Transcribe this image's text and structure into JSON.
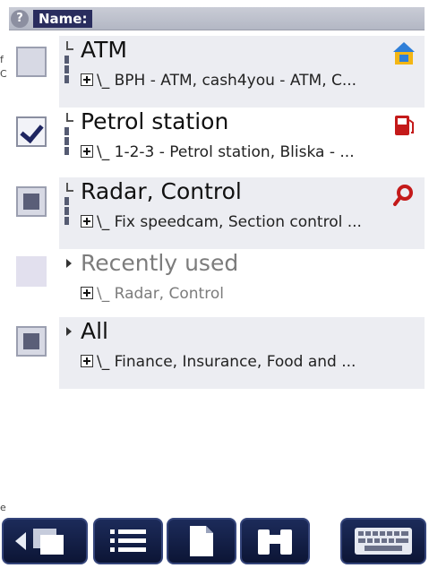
{
  "header": {
    "help_icon": "?",
    "title": "Name:"
  },
  "edge_fragments": [
    "f",
    "C",
    "e"
  ],
  "categories": [
    {
      "name": "ATM",
      "subtitle": "\\_ BPH - ATM, cash4you - ATM, C...",
      "checkbox": "empty",
      "icon": "atm-icon"
    },
    {
      "name": "Petrol station",
      "subtitle": "\\_ 1-2-3 - Petrol station, Bliska - ...",
      "checkbox": "checked",
      "icon": "fuel-pump-icon"
    },
    {
      "name": "Radar, Control",
      "subtitle": "\\_ Fix speedcam, Section control ...",
      "checkbox": "partial",
      "icon": "magnifier-icon"
    },
    {
      "name": "Recently used",
      "subtitle": "\\_ Radar, Control",
      "checkbox": "faint",
      "icon": ""
    },
    {
      "name": "All",
      "subtitle": "\\_ Finance, Insurance, Food and ...",
      "checkbox": "partial",
      "icon": ""
    }
  ],
  "toolbar": {
    "buttons": [
      "back-button",
      "list-view-button",
      "document-button",
      "binoculars-button",
      "keyboard-button"
    ]
  },
  "colors": {
    "toolbar_bg": "#0c1535",
    "header_title_bg": "#2a2d5e",
    "panel_bg": "#ecedf2"
  }
}
